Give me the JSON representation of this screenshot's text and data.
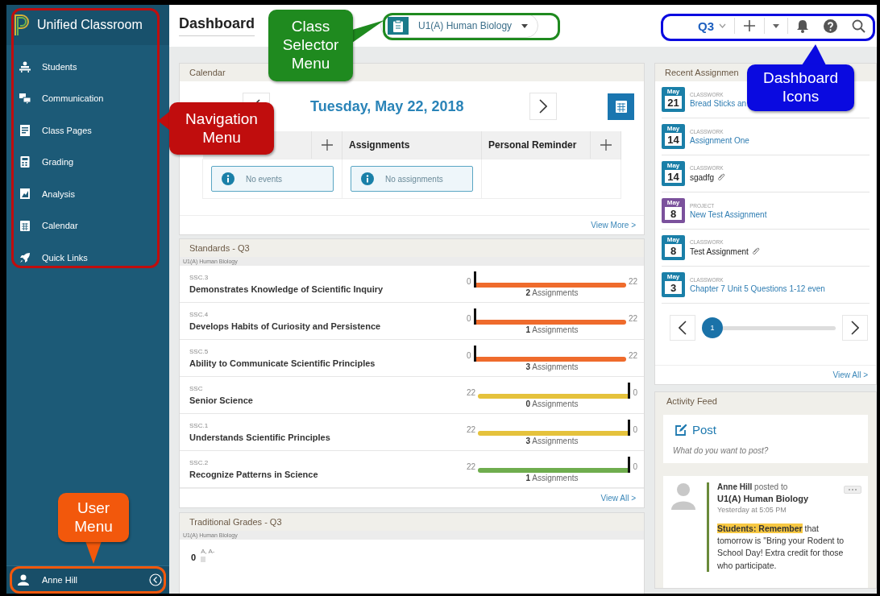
{
  "sidebar": {
    "app_title": "Unified Classroom",
    "items": [
      {
        "label": "Students"
      },
      {
        "label": "Communication"
      },
      {
        "label": "Class Pages"
      },
      {
        "label": "Grading"
      },
      {
        "label": "Analysis"
      },
      {
        "label": "Calendar"
      },
      {
        "label": "Quick Links"
      }
    ],
    "user": {
      "name": "Anne Hill"
    }
  },
  "page_title": "Dashboard",
  "class_selector": {
    "label": "U1(A) Human Biology"
  },
  "toolbar": {
    "term": "Q3"
  },
  "calendar": {
    "title": "Calendar",
    "date": "Tuesday, May 22, 2018",
    "columns": [
      {
        "add": true
      },
      {
        "label": "Assignments",
        "add": false,
        "message": "No assignments"
      },
      {
        "label": "Personal Reminder",
        "add": true
      }
    ],
    "first_message": "No events",
    "footer_link": "View More >"
  },
  "standards": {
    "title": "Standards - Q3",
    "class_name": "U1(A) Human Biology",
    "rows": [
      {
        "code": "SSC.3",
        "name": "Demonstrates Knowledge of Scientific Inquiry",
        "left_label": "0",
        "right_label": "22",
        "marker_end": false,
        "color": "#ef6b2c",
        "assignments": "**2** Assignments"
      },
      {
        "code": "SSC.4",
        "name": "Develops Habits of Curiosity and Persistence",
        "left_label": "0",
        "right_label": "22",
        "marker_end": false,
        "color": "#ef6b2c",
        "assignments": "**1** Assignments"
      },
      {
        "code": "SSC.5",
        "name": "Ability to Communicate Scientific Principles",
        "left_label": "0",
        "right_label": "22",
        "marker_end": false,
        "color": "#ef6b2c",
        "assignments": "**3** Assignments"
      },
      {
        "code": "SSC",
        "name": "Senior Science",
        "left_label": "22",
        "right_label": "0",
        "marker_end": true,
        "color": "#e5c23c",
        "assignments": "**0** Assignments"
      },
      {
        "code": "SSC.1",
        "name": "Understands Scientific Principles",
        "left_label": "22",
        "right_label": "0",
        "marker_end": true,
        "color": "#e5c23c",
        "assignments": "**3** Assignments"
      },
      {
        "code": "SSC.2",
        "name": "Recognize Patterns in Science",
        "left_label": "22",
        "right_label": "0",
        "marker_end": true,
        "color": "#6fad4e",
        "assignments": "**1** Assignments"
      }
    ],
    "footer_link": "View All >"
  },
  "traditional_grades": {
    "title": "Traditional Grades - Q3",
    "class_name": "U1(A) Human Biology",
    "rows": [
      {
        "count": "0",
        "grades": "A, A-"
      }
    ]
  },
  "recent_assignments": {
    "title": "Recent Assignmen",
    "items": [
      {
        "month": "May",
        "day": "21",
        "type": "CLASSWORK",
        "title": "Bread Sticks an",
        "color": "#1a7fa8",
        "linked": true,
        "attachment": false
      },
      {
        "month": "May",
        "day": "14",
        "type": "CLASSWORK",
        "title": "Assignment One",
        "color": "#1a7fa8",
        "linked": true,
        "attachment": false
      },
      {
        "month": "May",
        "day": "14",
        "type": "CLASSWORK",
        "title": "sgadfg",
        "color": "#1a7fa8",
        "linked": false,
        "attachment": true
      },
      {
        "month": "May",
        "day": "8",
        "type": "PROJECT",
        "title": "New Test Assignment",
        "color": "#7b519c",
        "linked": true,
        "attachment": false
      },
      {
        "month": "May",
        "day": "8",
        "type": "CLASSWORK",
        "title": "Test Assignment",
        "color": "#1a7fa8",
        "linked": false,
        "attachment": true
      },
      {
        "month": "May",
        "day": "3",
        "type": "CLASSWORK",
        "title": "Chapter 7 Unit 5 Questions 1-12 even",
        "color": "#1a7fa8",
        "linked": true,
        "attachment": false
      }
    ],
    "pages": [
      {
        "label": "1",
        "selected": true
      }
    ],
    "footer_link": "View All >"
  },
  "activity_feed": {
    "title": "Activity Feed",
    "post_label": "Post",
    "post_placeholder": "What do you want to post?",
    "posts": [
      {
        "author_line": "**Anne Hill** posted to",
        "class_name": "U1(A) Human Biology",
        "time": "Yesterday at 5:05 PM",
        "body": "**Students: Remember** that tomorrow is \"Bring your Rodent to School Day! Extra credit for those who participate."
      }
    ]
  },
  "callouts": [
    {
      "text": "Navigation Menu",
      "color": "#c00d0d"
    },
    {
      "text": "User Menu",
      "color": "#f2580c"
    },
    {
      "text": "Class Selector Menu",
      "color": "#1f8a1f"
    },
    {
      "text": "Dashboard Icons",
      "color": "#0a0ae0"
    }
  ]
}
